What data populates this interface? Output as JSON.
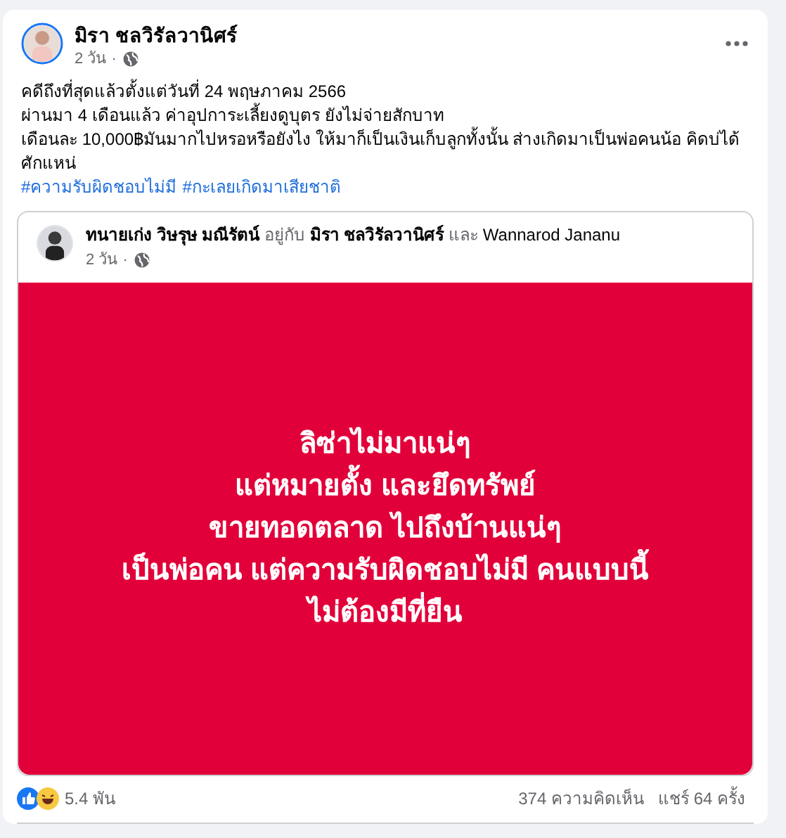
{
  "post": {
    "author": "มิรา ชลวิรัลวานิศร์",
    "time": "2 วัน ·",
    "body_lines": [
      "คดีถึงที่สุดแล้วตั้งแต่วันที่ 24 พฤษภาคม 2566",
      "ผ่านมา 4 เดือนแล้ว ค่าอุปการะเลี้ยงดูบุตร ยังไม่จ่ายสักบาท",
      "เดือนละ 10,000฿มันมากไปหรอหรือยังไง ให้มาก็เป็นเงินเก็บลูกทั้งนั้น ส่างเกิดมาเป็นพ่อคนน้อ คิดบ่ได้ศักแหน่"
    ],
    "hashtags": [
      "#ความรับผิดชอบไม่มี",
      "#กะเลยเกิดมาเสียชาติ"
    ]
  },
  "shared": {
    "author": "ทนายเก่ง วิษรุษ มณีรัตน์",
    "with_word": "อยู่กับ",
    "tagged": "มิรา ชลวิรัลวานิศร์",
    "and_word": "และ",
    "tagged_2": "Wannarod Jananu",
    "time": "2 วัน ·",
    "image_lines": [
      "ลิซ่าไม่มาแน่ๆ",
      "แต่หมายตั้ง และยึดทรัพย์",
      "ขายทอดตลาด ไปถึงบ้านแน่ๆ",
      "เป็นพ่อคน แต่ความรับผิดชอบไม่มี คนแบบนี้",
      "ไม่ต้องมีที่ยืน"
    ]
  },
  "footer": {
    "reactions": "5.4 พัน",
    "comments": "374 ความคิดเห็น",
    "shares": "แชร์ 64 ครั้ง"
  }
}
